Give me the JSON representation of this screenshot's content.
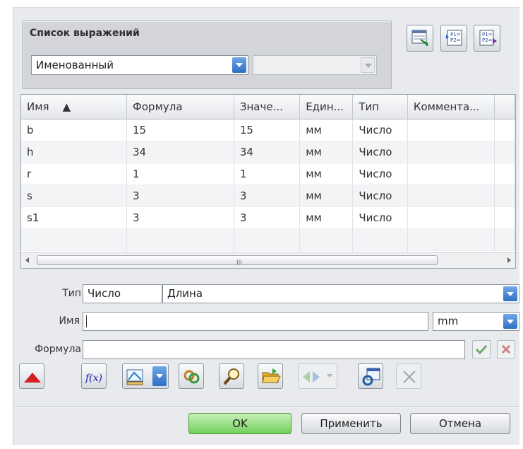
{
  "expression_list": {
    "title": "Список выражений",
    "filter_value": "Именованный",
    "second_value": ""
  },
  "toolbar_top": {
    "icons": [
      "list-view-icon",
      "export-expressions-icon",
      "import-expressions-icon"
    ]
  },
  "table": {
    "columns": [
      "Имя",
      "Формула",
      "Значе...",
      "Един...",
      "Тип",
      "Коммента..."
    ],
    "sort_indicator": "▲",
    "rows": [
      [
        "b",
        "15",
        "15",
        "мм",
        "Число",
        ""
      ],
      [
        "h",
        "34",
        "34",
        "мм",
        "Число",
        ""
      ],
      [
        "r",
        "1",
        "1",
        "мм",
        "Число",
        ""
      ],
      [
        "s",
        "3",
        "3",
        "мм",
        "Число",
        ""
      ],
      [
        "s1",
        "3",
        "3",
        "мм",
        "Число",
        ""
      ],
      [
        "",
        "",
        "",
        "",
        "",
        ""
      ],
      [
        "",
        "",
        "",
        "",
        "",
        ""
      ]
    ],
    "scroll_grip": "III"
  },
  "editor": {
    "type_label": "Тип",
    "type_value": "Число",
    "dimension_value": "Длина",
    "name_label": "Имя",
    "name_value": "",
    "unit_value": "mm",
    "formula_label": "Формула",
    "formula_value": ""
  },
  "buttons": {
    "ok": "OK",
    "apply": "Применить",
    "cancel": "Отмена"
  },
  "colors": {
    "accent_blue": "#3a7bd5",
    "ok_green": "#72d05a",
    "alert_red": "#d42020"
  }
}
